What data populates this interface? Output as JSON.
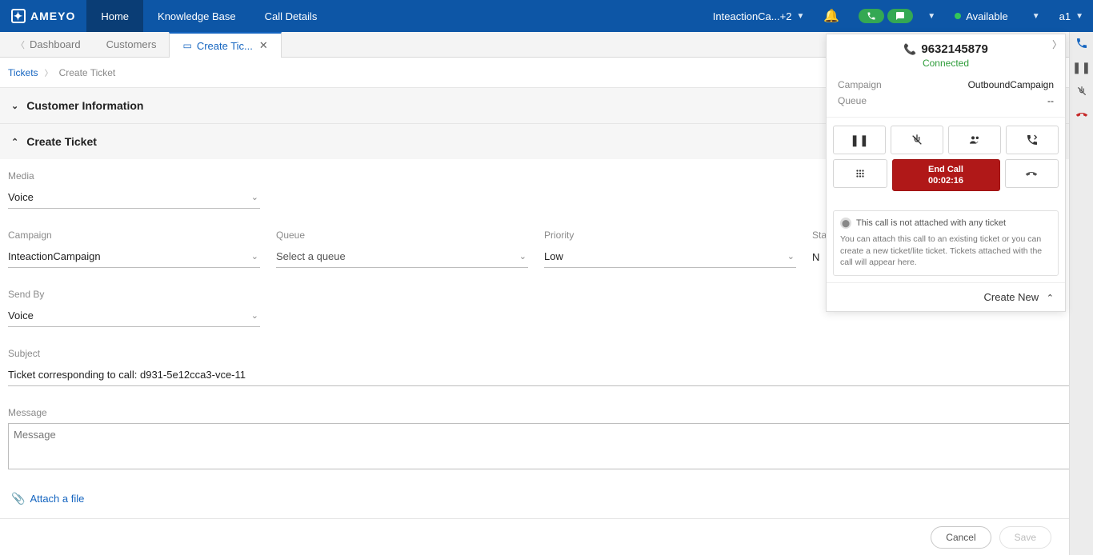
{
  "brand": "AMEYO",
  "nav": {
    "home": "Home",
    "kb": "Knowledge Base",
    "calls": "Call Details"
  },
  "header": {
    "campaign_display": "InteactionCa...+2",
    "available": "Available",
    "user": "a1"
  },
  "tabs": {
    "dashboard": "Dashboard",
    "customers": "Customers",
    "create_ticket": "Create Tic..."
  },
  "breadcrumb": {
    "root": "Tickets",
    "current": "Create Ticket"
  },
  "sections": {
    "customer_info": "Customer Information",
    "create_ticket": "Create Ticket"
  },
  "form": {
    "media": {
      "label": "Media",
      "value": "Voice"
    },
    "campaign": {
      "label": "Campaign",
      "value": "InteactionCampaign"
    },
    "queue": {
      "label": "Queue",
      "value": "Select a queue"
    },
    "priority": {
      "label": "Priority",
      "value": "Low"
    },
    "status_label": "Sta",
    "status_value_trunc": "N",
    "send_by": {
      "label": "Send By",
      "value": "Voice"
    },
    "subject": {
      "label": "Subject",
      "value": "Ticket corresponding to call: d931-5e12cca3-vce-11"
    },
    "message": {
      "label": "Message",
      "placeholder": "Message"
    },
    "attach": "Attach a file"
  },
  "footer": {
    "cancel": "Cancel",
    "save": "Save"
  },
  "call": {
    "phone": "9632145879",
    "status": "Connected",
    "campaign_key": "Campaign",
    "campaign_val": "OutboundCampaign",
    "queue_key": "Queue",
    "queue_val": "--",
    "end_label": "End Call",
    "end_time": "00:02:16",
    "not_attached": "This call is not attached with any ticket",
    "hint": "You can attach this call to an existing ticket or you can create a new ticket/lite ticket. Tickets attached with the call will appear here.",
    "create_new": "Create New"
  }
}
